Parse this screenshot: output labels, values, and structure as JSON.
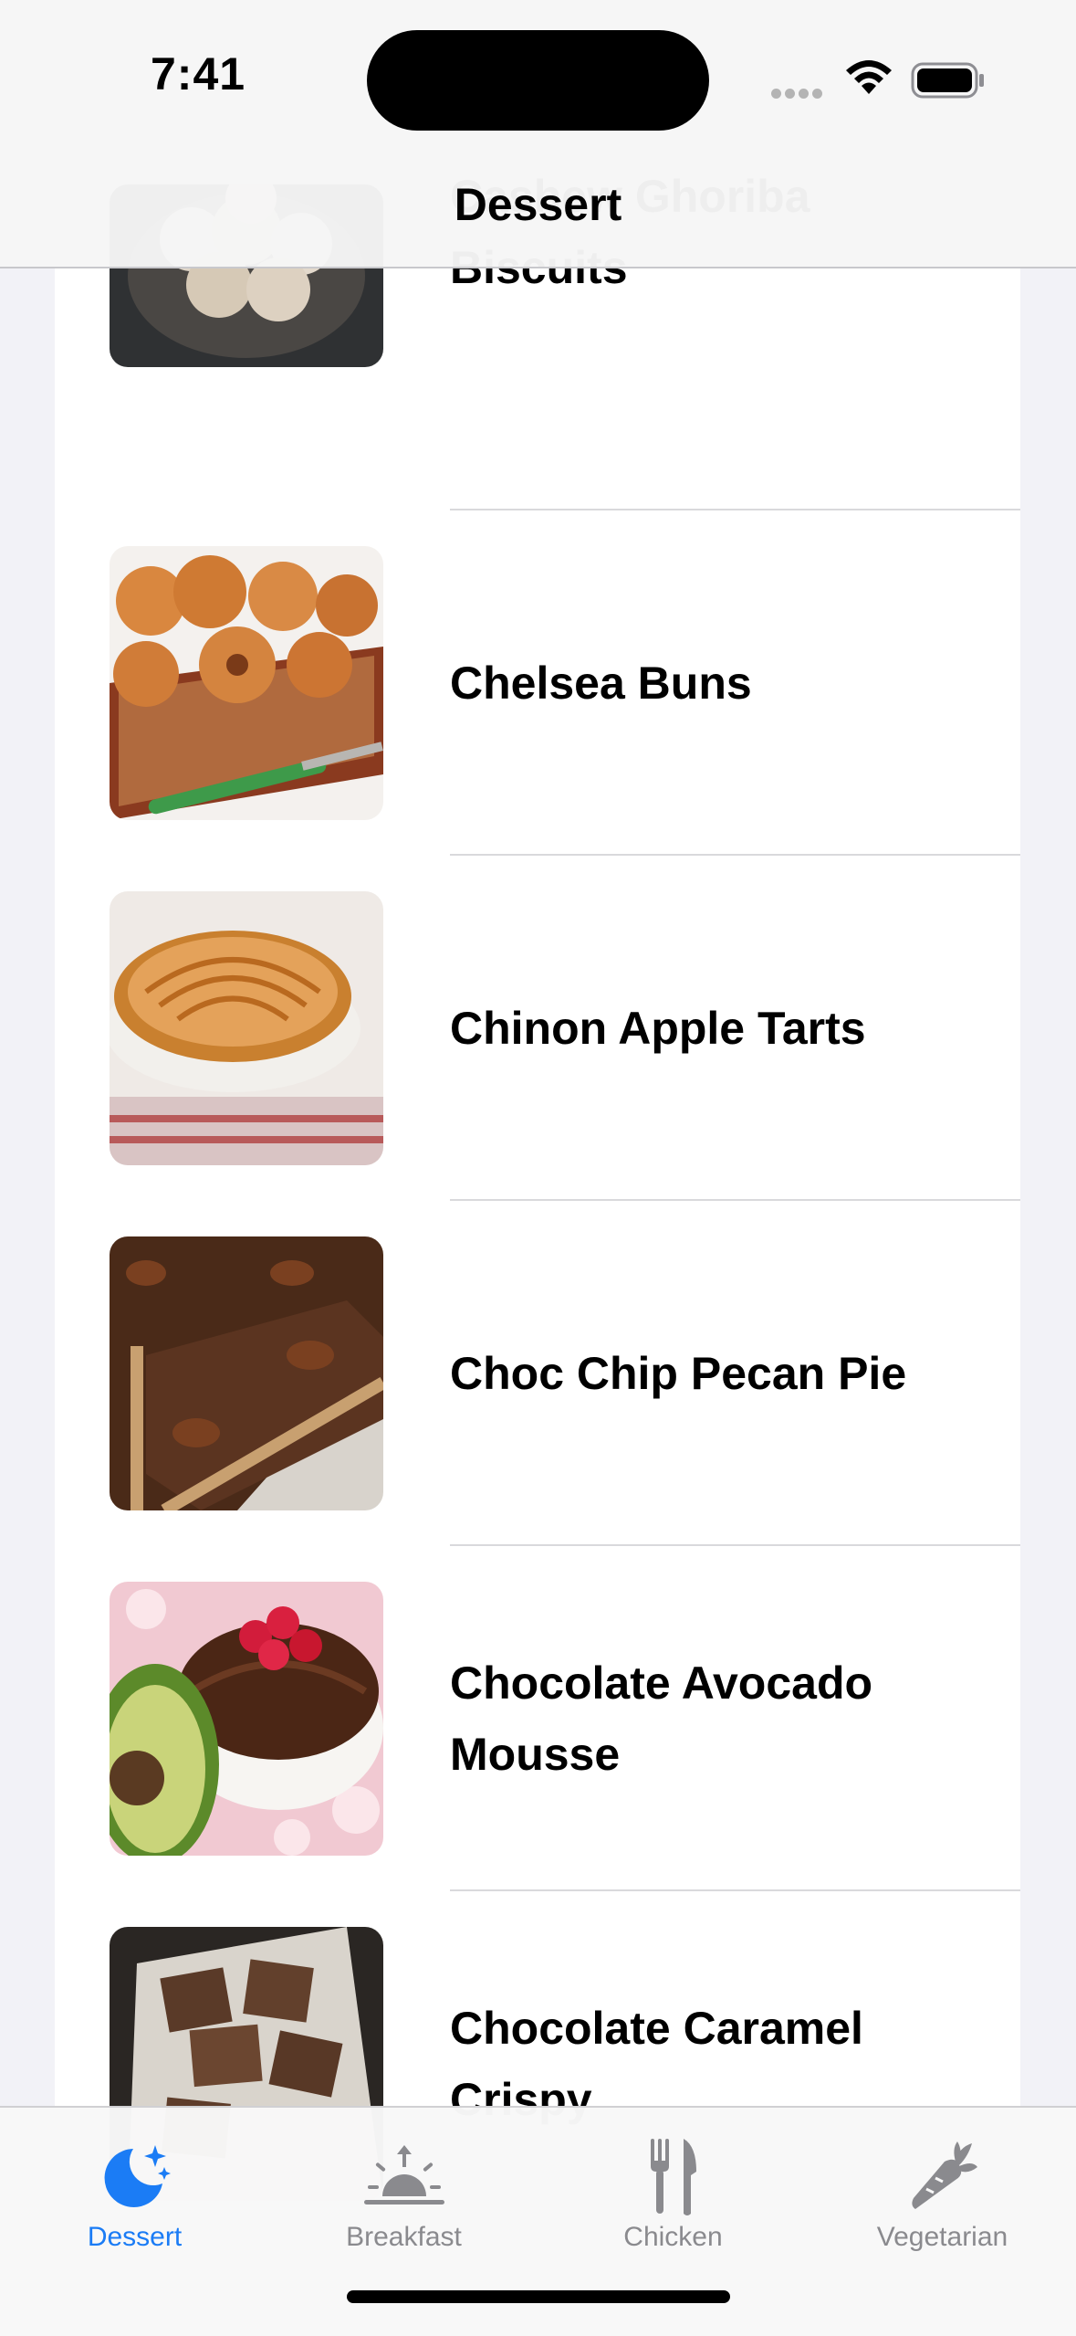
{
  "status_bar": {
    "time": "7:41"
  },
  "nav": {
    "title": "Dessert"
  },
  "meals": [
    {
      "name": "Cashew Ghoriba Biscuits"
    },
    {
      "name": "Chelsea Buns"
    },
    {
      "name": "Chinon Apple Tarts"
    },
    {
      "name": "Choc Chip Pecan Pie"
    },
    {
      "name": "Chocolate Avocado Mousse"
    },
    {
      "name": "Chocolate Caramel Crispy"
    }
  ],
  "tabs": [
    {
      "label": "Dessert",
      "icon": "moon-stars-icon",
      "active": true
    },
    {
      "label": "Breakfast",
      "icon": "sunrise-icon",
      "active": false
    },
    {
      "label": "Chicken",
      "icon": "fork-knife-icon",
      "active": false
    },
    {
      "label": "Vegetarian",
      "icon": "carrot-icon",
      "active": false
    }
  ],
  "colors": {
    "accent": "#1b7cf5",
    "inactive": "#8a8a8e"
  }
}
